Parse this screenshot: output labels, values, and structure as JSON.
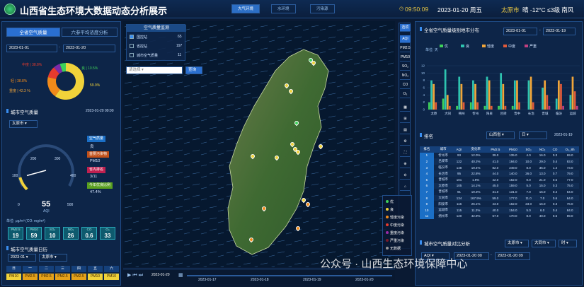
{
  "header": {
    "title": "山西省生态环境大数据动态分析展示",
    "nav": [
      "大气环境",
      "水环境",
      "污染源"
    ],
    "time": "09:50:09",
    "date": "2023-01-20",
    "weekday": "周五",
    "city": "太原市",
    "weather": "晴 -12°C ≤3级 南风"
  },
  "left": {
    "tabs": [
      "全省空气质量",
      "六参平均浓度分析"
    ],
    "date_from": "2023-01-01",
    "date_to": "2023-01-20",
    "donut": {
      "segments": [
        {
          "label": "良",
          "pct": "59.9%",
          "color": "#f0d23a",
          "value": 59.9
        },
        {
          "label": "轻度",
          "pct": "38.8%",
          "color": "#f08a1a",
          "value": 18.8
        },
        {
          "label": "中度",
          "pct": "",
          "color": "#e53b2d",
          "value": 10.0
        },
        {
          "label": "重度",
          "pct": "",
          "color": "#7b2aa8",
          "value": 6.0
        },
        {
          "label": "优",
          "pct": "10.5%",
          "color": "#3ed05a",
          "value": 5.3
        }
      ],
      "labels": [
        "良 | 10.5%",
        "中度 | 38.8%",
        "轻 | 38.8%",
        "重度 | 42.3 %"
      ]
    },
    "city_section": "城市空气质量",
    "city_time": "2023-01-20 09:00",
    "city_select": "太原市",
    "gauge": {
      "t0": "0",
      "t100": "100",
      "t200": "200",
      "t300": "300",
      "t400": "400",
      "t500": "500",
      "value": "55",
      "unit": "AQI",
      "level": 55
    },
    "side_tags": [
      {
        "k": "空气质量",
        "v": "良"
      },
      {
        "k": "首要污染物",
        "v": "PM10"
      },
      {
        "k": "省内排名",
        "v": "3/11"
      },
      {
        "k": "今年优良比例",
        "v": "47.4%"
      }
    ],
    "unit_line": "单位: μg/m³ (CO: mg/m³)",
    "pollutants": [
      {
        "name": "PM2.5",
        "value": "19"
      },
      {
        "name": "PM10",
        "value": "59"
      },
      {
        "name": "SO₂",
        "value": "10"
      },
      {
        "name": "NO₂",
        "value": "26"
      },
      {
        "name": "CO",
        "value": "0.6"
      },
      {
        "name": "O₃",
        "value": "33"
      }
    ],
    "calendar_section": "城市空气质量日历",
    "cal_date": "2023-01",
    "cal_city": "太原市",
    "weekdays": [
      "日",
      "一",
      "二",
      "三",
      "四",
      "五",
      "六"
    ],
    "cal_row": [
      "PM10",
      "PM2.5",
      "PM2.5",
      "PM2.5",
      "PM2.5",
      "PM10",
      "PM10"
    ]
  },
  "map": {
    "panel_title": "空气质量监测",
    "rows": [
      {
        "label": "国控站",
        "count": "65"
      },
      {
        "label": "省控站",
        "count": "197"
      },
      {
        "label": "城市空气质量",
        "count": "11"
      }
    ],
    "select_placeholder": "请选择",
    "query": "查询",
    "legend": [
      "优",
      "良",
      "轻度污染",
      "中度污染",
      "重度污染",
      "严重污染",
      "无数据"
    ],
    "timeline": {
      "current": "2023-01-20",
      "dates": [
        "2023-01-17",
        "2023-01-18",
        "2023-01-19",
        "2023-01-20"
      ]
    }
  },
  "sidebar": {
    "items": [
      "选项",
      "AQI",
      "PM2.5",
      "PM10",
      "SO₂",
      "NO₂",
      "CO",
      "O₃"
    ]
  },
  "right": {
    "chart_title": "全省空气质量级别地市分布",
    "date_from": "2023-01-01",
    "date_to": "2023-01-19",
    "unit": "单位: 天",
    "chart_data": {
      "type": "bar",
      "categories": [
        "太原",
        "大同",
        "朔州",
        "忻州",
        "阳泉",
        "吕梁",
        "晋中",
        "长治",
        "晋城",
        "临汾",
        "运城"
      ],
      "ylim": [
        0,
        12
      ],
      "yticks": [
        "0",
        "2",
        "4",
        "6",
        "8",
        "10",
        "12"
      ],
      "series": [
        {
          "name": "优",
          "color": "#3ed05a",
          "values": [
            2,
            3,
            1,
            2,
            1,
            1,
            1,
            0,
            0,
            0,
            0
          ]
        },
        {
          "name": "良",
          "color": "#2ec4b0",
          "values": [
            8,
            11,
            9,
            8,
            9,
            10,
            8,
            8,
            6,
            3,
            4
          ]
        },
        {
          "name": "轻度",
          "color": "#f0a53a",
          "values": [
            7,
            4,
            7,
            7,
            8,
            7,
            8,
            9,
            8,
            8,
            9
          ]
        },
        {
          "name": "中度",
          "color": "#e05a3a",
          "values": [
            2,
            1,
            2,
            2,
            1,
            1,
            2,
            2,
            4,
            7,
            5
          ]
        },
        {
          "name": "严重",
          "color": "#c04080",
          "values": [
            0,
            0,
            0,
            0,
            0,
            0,
            0,
            0,
            1,
            1,
            1
          ]
        }
      ]
    },
    "rank_section": "排名",
    "rank_region": "山西省",
    "rank_type": "日",
    "rank_date": "2023-01-19",
    "table": {
      "headers": [
        "排名",
        "城市",
        "AQI",
        "变化率",
        "PM2.5",
        "PM10",
        "SO₂",
        "NO₂",
        "CO",
        "O₃_8h"
      ],
      "rows": [
        [
          "1",
          "忻州市",
          "93",
          "12.0%",
          "39.0",
          "135.0",
          "4.0",
          "16.0",
          "0.3",
          "69.0"
        ],
        [
          "2",
          "吕梁市",
          "122",
          "40.2%",
          "41.0",
          "194.0",
          "10.0",
          "29.0",
          "0.4",
          "93.0"
        ],
        [
          "3",
          "临汾市",
          "148",
          "19.4%",
          "82.0",
          "249.0",
          "8.0",
          "35.0",
          "1.4",
          "73.0"
        ],
        [
          "4",
          "长治市",
          "95",
          "22.8%",
          "44.0",
          "140.0",
          "26.0",
          "13.0",
          "0.7",
          "79.0"
        ],
        [
          "5",
          "晋城市",
          "101",
          "1.9%",
          "42.0",
          "152.0",
          "0.0",
          "21.0",
          "0.5",
          "77.0"
        ],
        [
          "6",
          "太原市",
          "105",
          "14.1%",
          "45.0",
          "159.0",
          "5.0",
          "15.0",
          "0.3",
          "75.0"
        ],
        [
          "7",
          "晋城市",
          "91",
          "19.3%",
          "31.0",
          "131.0",
          "7.0",
          "16.0",
          "0.4",
          "64.0"
        ],
        [
          "8",
          "大同市",
          "134",
          "167.9%",
          "59.0",
          "177.0",
          "11.0",
          "7.0",
          "0.6",
          "64.0"
        ],
        [
          "9",
          "阳泉市",
          "116",
          "26.1%",
          "43.0",
          "162.0",
          "23.0",
          "16.0",
          "0.3",
          "76.0"
        ],
        [
          "10",
          "运城市",
          "115",
          "11.2%",
          "40.0",
          "154.0",
          "5.0",
          "6.0",
          "0.4",
          "84.0"
        ],
        [
          "11",
          "朔州市",
          "120",
          "42.9%",
          "67.0",
          "170.0",
          "8.0",
          "40.0",
          "0.5",
          "89.0"
        ]
      ]
    },
    "compare_section": "城市空气质量对比分析",
    "cmp_city1": "太原市",
    "cmp_city2": "大同市",
    "cmp_period": "时",
    "cmp_metric": "AQI",
    "cmp_from": "2023-01-20 00",
    "cmp_to": "2023-01-20 09"
  },
  "watermark": "公众号 · 山西生态环境保障中心"
}
